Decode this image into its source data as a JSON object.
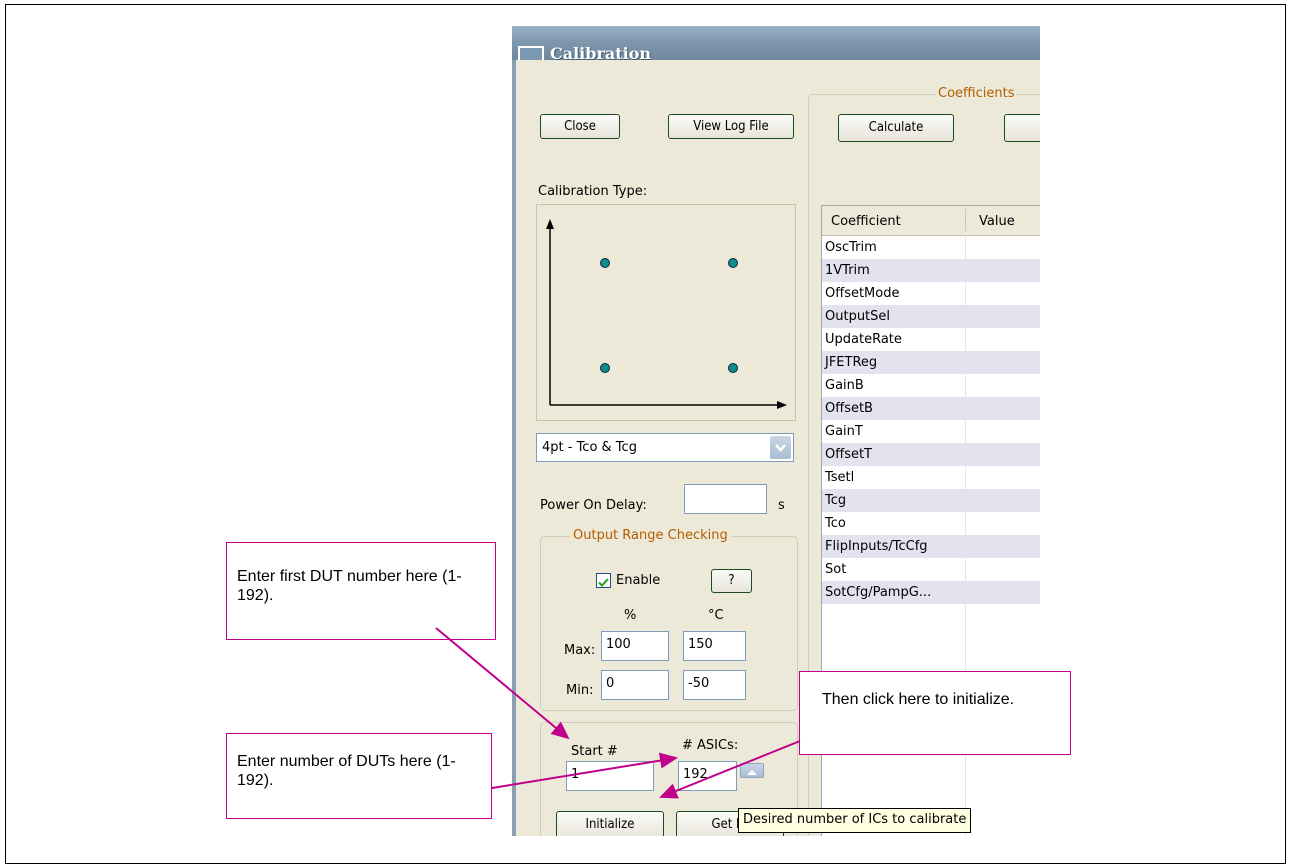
{
  "window": {
    "title": "Calibration"
  },
  "buttons": {
    "close": "Close",
    "view_log": "View Log File",
    "calculate": "Calculate",
    "help": "?",
    "initialize": "Initialize",
    "get_id": "Get ID"
  },
  "calibration_type": {
    "label": "Calibration Type:",
    "selected": "4pt - Tco & Tcg"
  },
  "power_on_delay": {
    "label": "Power On Delay:",
    "value": "",
    "unit": "s"
  },
  "output_range": {
    "title": "Output Range Checking",
    "enable_label": "Enable",
    "enabled": true,
    "col_percent": "%",
    "col_celsius": "°C",
    "max_label": "Max:",
    "min_label": "Min:",
    "max_percent": "100",
    "max_celsius": "150",
    "min_percent": "0",
    "min_celsius": "-50"
  },
  "asic": {
    "start_label": "Start #",
    "count_label": "# ASICs:",
    "start_value": "1",
    "count_value": "192"
  },
  "coefficients": {
    "title": "Coefficients",
    "headers": [
      "Coefficient",
      "Value"
    ],
    "rows": [
      "OscTrim",
      "1VTrim",
      "OffsetMode",
      "OutputSel",
      "UpdateRate",
      "JFETReg",
      "GainB",
      "OffsetB",
      "GainT",
      "OffsetT",
      "Tsetl",
      "Tcg",
      "Tco",
      "FlipInputs/TcCfg",
      "Sot",
      "SotCfg/PampG..."
    ]
  },
  "tooltip": "Desired number of ICs to calibrate",
  "callouts": {
    "first_dut": "Enter first DUT number here (1-192).",
    "num_duts": "Enter number of DUTs here (1-192).",
    "initialize": "Then click here to initialize."
  },
  "colors": {
    "callout_border": "#c0008a",
    "group_title": "#b35c00",
    "point": "#0f8c8c"
  },
  "icons": {
    "checkbox": "check-icon",
    "dropdown": "chevron-down-icon",
    "spinner": "arrow-up-icon"
  }
}
